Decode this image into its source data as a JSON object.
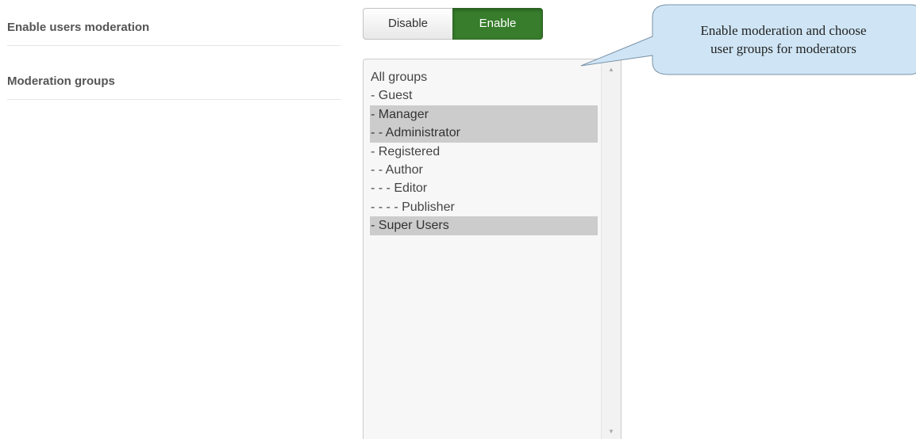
{
  "fields": {
    "moderation_label": "Enable users moderation",
    "groups_label": "Moderation groups"
  },
  "toggle": {
    "disable_label": "Disable",
    "enable_label": "Enable",
    "active": "Enable",
    "active_color": "#377d2c"
  },
  "groups": {
    "options": [
      {
        "label": "All groups",
        "selected": false
      },
      {
        "label": "- Guest",
        "selected": false
      },
      {
        "label": "- Manager",
        "selected": true
      },
      {
        "label": "- - Administrator",
        "selected": true
      },
      {
        "label": "- Registered",
        "selected": false
      },
      {
        "label": "- - Author",
        "selected": false
      },
      {
        "label": "- - - Editor",
        "selected": false
      },
      {
        "label": "- - - - Publisher",
        "selected": false
      },
      {
        "label": "- Super Users",
        "selected": true
      }
    ]
  },
  "callout": {
    "line1": "Enable moderation and choose",
    "line2": "user groups for moderators",
    "fill_color": "#cfe5f5"
  }
}
